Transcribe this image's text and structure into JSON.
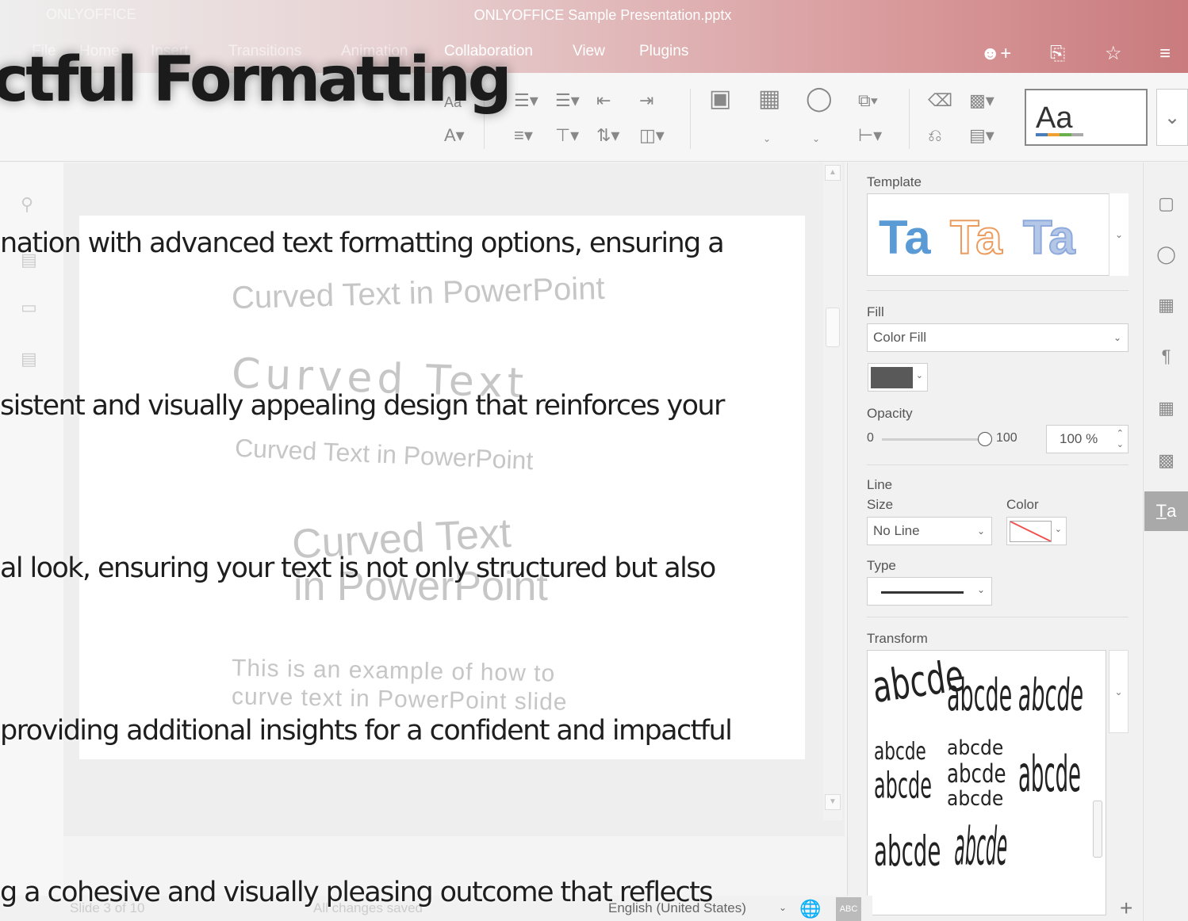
{
  "window": {
    "app_name": "ONLYOFFICE",
    "title": "ONLYOFFICE Sample Presentation.pptx"
  },
  "menu_tabs": [
    "File",
    "Home",
    "Insert",
    "Transitions",
    "Animation",
    "Collaboration",
    "View",
    "Plugins"
  ],
  "toolbar": {
    "theme_preview_label": "Aa",
    "font_size_short": "Aa"
  },
  "slide": {
    "curved_text": [
      "Curved Text in PowerPoint",
      "Curved Text",
      "Curved Text in PowerPoint",
      "Curved Text",
      "in PowerPoint",
      "This is an example of how to",
      "curve text in PowerPoint slide"
    ]
  },
  "overlay": {
    "heading": "ctful Formatting",
    "lines": [
      "nation with advanced text formatting options, ensuring a",
      "sistent and visually appealing design that reinforces your",
      "al look, ensuring your text is not only structured but also",
      "providing additional insights for a confident and impactful",
      "g a cohesive and visually pleasing outcome that reflects"
    ]
  },
  "panel": {
    "template_label": "Template",
    "template_samples": [
      "Ta",
      "Ta",
      "Ta"
    ],
    "fill_label": "Fill",
    "fill_value": "Color Fill",
    "opacity_label": "Opacity",
    "opacity_min": "0",
    "opacity_max": "100",
    "opacity_value": "100 %",
    "line_label": "Line",
    "size_label": "Size",
    "color_label": "Color",
    "size_value": "No Line",
    "type_label": "Type",
    "transform_label": "Transform",
    "transform_samples": [
      "abcde",
      "abcde",
      "abcde",
      "abcde",
      "abcde",
      "abcde",
      "abcde",
      "abcde",
      "abcde",
      "abcde",
      "abcde"
    ]
  },
  "status": {
    "slide_counter": "Slide 3 of 10",
    "save_state": "All changes saved",
    "language": "English (United States)"
  },
  "colors": {
    "title_bar_accent": "#c97b7d",
    "template_blue": "#5b9bd5",
    "template_orange": "#ed9c5f",
    "template_gray_blue": "#8faadc",
    "fill_swatch": "#595959",
    "rail_active": "#a9a9a9"
  },
  "icons": [
    "add-user-icon",
    "open-location-icon",
    "favorite-star-icon",
    "hamburger-menu-icon",
    "text-box-icon",
    "image-icon",
    "shape-icon",
    "arrange-icon",
    "align-icon",
    "eraser-icon",
    "copy-style-icon",
    "slide-settings-icon",
    "shape-settings-icon",
    "image-settings-icon",
    "paragraph-icon",
    "table-icon",
    "chart-icon",
    "text-art-icon",
    "globe-icon",
    "spellcheck-icon",
    "zoom-in-icon"
  ]
}
